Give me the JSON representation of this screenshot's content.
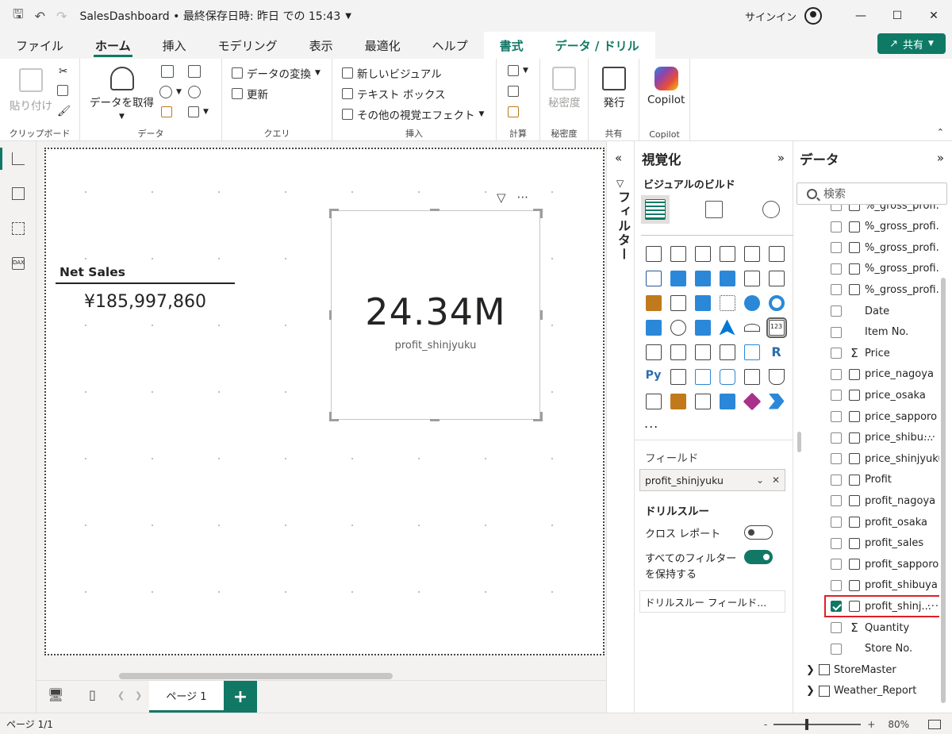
{
  "app": {
    "title": "SalesDashboard • 最終保存日時: 昨日 での 15:43",
    "signin": "サインイン"
  },
  "tabs": [
    "ファイル",
    "ホーム",
    "挿入",
    "モデリング",
    "表示",
    "最適化",
    "ヘルプ",
    "書式",
    "データ / ドリル"
  ],
  "share_label": "共有",
  "ribbon": {
    "paste": "貼り付け",
    "clipboard_group": "クリップボード",
    "get_data": "データを取得",
    "data_group": "データ",
    "transform": "データの変換",
    "refresh": "更新",
    "query_group": "クエリ",
    "new_visual": "新しいビジュアル",
    "textbox": "テキスト ボックス",
    "more_visuals": "その他の視覚エフェクト",
    "insert_group": "挿入",
    "calc_group": "計算",
    "sensitivity": "秘密度",
    "sensitivity_group": "秘密度",
    "publish": "発行",
    "share_group": "共有",
    "copilot": "Copilot",
    "copilot_group": "Copilot"
  },
  "canvas": {
    "card1": {
      "label": "Net Sales",
      "value": "¥185,997,860"
    },
    "card2": {
      "value": "24.34M",
      "label": "profit_shinjyuku"
    }
  },
  "pagebar": {
    "page_tab": "ページ 1",
    "add": "+"
  },
  "status": {
    "page": "ページ 1/1",
    "zoom": "80%"
  },
  "filters_label": "フィルター",
  "viz": {
    "title": "視覚化",
    "build": "ビジュアルのビルド",
    "fields_label": "フィールド",
    "field_value": "profit_shinjyuku",
    "drill_title": "ドリルスルー",
    "cross_report": "クロス レポート",
    "keep_filters": "すべてのフィルター",
    "keep_filters2": "を保持する",
    "drill_field": "ドリルスルー フィールド...",
    "more": "..."
  },
  "datapane": {
    "title": "データ",
    "search_placeholder": "検索",
    "fields": [
      {
        "name": "%_gross_profi...",
        "icon": "calc",
        "checked": false
      },
      {
        "name": "%_gross_profi...",
        "icon": "calc",
        "checked": false
      },
      {
        "name": "%_gross_profi...",
        "icon": "calc",
        "checked": false
      },
      {
        "name": "%_gross_profi...",
        "icon": "calc",
        "checked": false
      },
      {
        "name": "%_gross_profi...",
        "icon": "calc",
        "checked": false
      },
      {
        "name": "Date",
        "icon": "none",
        "checked": false
      },
      {
        "name": "Item No.",
        "icon": "none",
        "checked": false
      },
      {
        "name": "Price",
        "icon": "sigma",
        "checked": false
      },
      {
        "name": "price_nagoya",
        "icon": "calc",
        "checked": false
      },
      {
        "name": "price_osaka",
        "icon": "calc",
        "checked": false
      },
      {
        "name": "price_sapporo",
        "icon": "calc",
        "checked": false
      },
      {
        "name": "price_shibu...",
        "icon": "calc",
        "checked": false,
        "dots": "···"
      },
      {
        "name": "price_shinjyuku",
        "icon": "calc",
        "checked": false
      },
      {
        "name": "Profit",
        "icon": "calc",
        "checked": false
      },
      {
        "name": "profit_nagoya",
        "icon": "calc",
        "checked": false
      },
      {
        "name": "profit_osaka",
        "icon": "calc",
        "checked": false
      },
      {
        "name": "profit_sales",
        "icon": "calc",
        "checked": false
      },
      {
        "name": "profit_sapporo",
        "icon": "calc",
        "checked": false
      },
      {
        "name": "profit_shibuya",
        "icon": "calc",
        "checked": false
      },
      {
        "name": "profit_shinj...",
        "icon": "calc",
        "checked": true,
        "dots": "···",
        "highlight": true
      },
      {
        "name": "Quantity",
        "icon": "sigma",
        "checked": false
      },
      {
        "name": "Store No.",
        "icon": "none",
        "checked": false
      }
    ],
    "tables": [
      "StoreMaster",
      "Weather_Report"
    ]
  },
  "colors": {
    "accent": "#117865",
    "highlight": "#e01f26"
  }
}
